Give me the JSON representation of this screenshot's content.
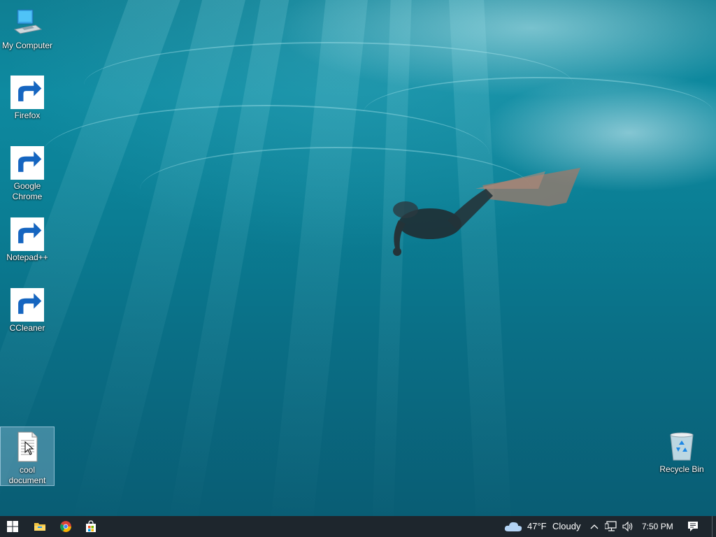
{
  "desktop": {
    "icons": [
      {
        "label": "My Computer"
      },
      {
        "label": "Firefox"
      },
      {
        "label": "Google Chrome"
      },
      {
        "label": "Notepad++"
      },
      {
        "label": "CCleaner"
      },
      {
        "label": "cool document"
      },
      {
        "label": "Recycle Bin"
      }
    ]
  },
  "taskbar": {
    "start_icon": "windows-logo-icon",
    "pinned": [
      "file-explorer-icon",
      "chrome-icon",
      "store-icon"
    ],
    "weather": {
      "temperature": "47°F",
      "condition": "Cloudy"
    },
    "clock": "7:50 PM",
    "colors": {
      "background": "#1e262d",
      "text": "#ffffff"
    }
  }
}
